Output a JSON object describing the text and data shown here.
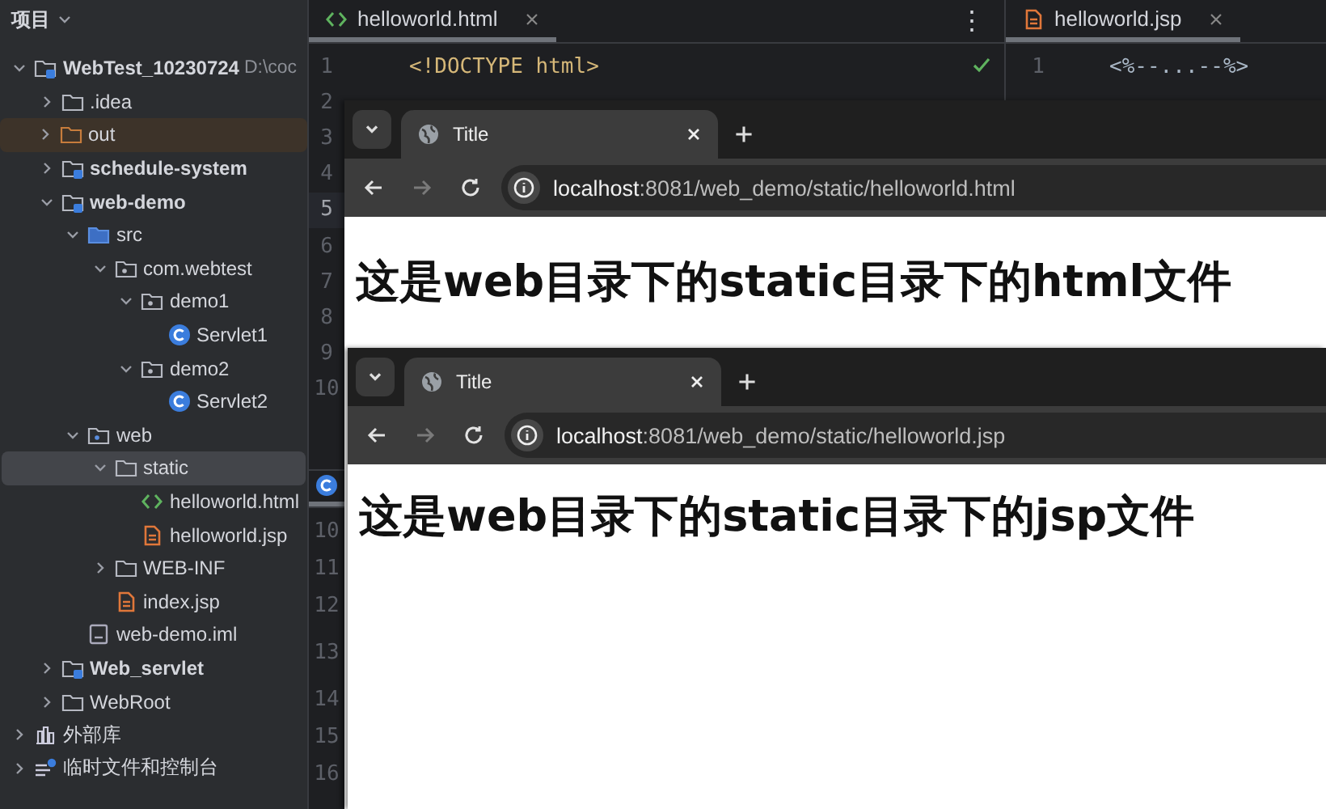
{
  "sidebar": {
    "title": "项目",
    "tree": [
      {
        "label": "WebTest_10230724",
        "path": "D:\\coc",
        "kind": "module",
        "expanded": true,
        "selected": false,
        "children": [
          {
            "label": ".idea",
            "kind": "folder",
            "expanded": false,
            "selected": false
          },
          {
            "label": "out",
            "kind": "excluded",
            "expanded": false,
            "selected": false
          },
          {
            "label": "schedule-system",
            "kind": "module",
            "expanded": false,
            "selected": false
          },
          {
            "label": "web-demo",
            "kind": "module",
            "expanded": true,
            "selected": false,
            "children": [
              {
                "label": "src",
                "kind": "source",
                "expanded": true,
                "selected": false,
                "children": [
                  {
                    "label": "com.webtest",
                    "kind": "package",
                    "expanded": true,
                    "selected": false,
                    "children": [
                      {
                        "label": "demo1",
                        "kind": "package",
                        "expanded": true,
                        "selected": false,
                        "children": [
                          {
                            "label": "Servlet1",
                            "kind": "class",
                            "selected": false
                          }
                        ]
                      },
                      {
                        "label": "demo2",
                        "kind": "package",
                        "expanded": true,
                        "selected": false,
                        "children": [
                          {
                            "label": "Servlet2",
                            "kind": "class",
                            "selected": false
                          }
                        ]
                      }
                    ]
                  }
                ]
              },
              {
                "label": "web",
                "kind": "web",
                "expanded": true,
                "selected": false,
                "children": [
                  {
                    "label": "static",
                    "kind": "folder",
                    "expanded": true,
                    "selected": true,
                    "children": [
                      {
                        "label": "helloworld.html",
                        "kind": "html",
                        "selected": false
                      },
                      {
                        "label": "helloworld.jsp",
                        "kind": "jsp",
                        "selected": false
                      }
                    ]
                  },
                  {
                    "label": "WEB-INF",
                    "kind": "folder",
                    "expanded": false,
                    "selected": false
                  },
                  {
                    "label": "index.jsp",
                    "kind": "jsp",
                    "selected": false
                  }
                ]
              },
              {
                "label": "web-demo.iml",
                "kind": "file",
                "selected": false
              }
            ]
          },
          {
            "label": "Web_servlet",
            "kind": "module",
            "expanded": false,
            "selected": false
          },
          {
            "label": "WebRoot",
            "kind": "folder",
            "expanded": false,
            "selected": false
          }
        ]
      },
      {
        "label": "外部库",
        "kind": "library",
        "expanded": false,
        "selected": false
      },
      {
        "label": "临时文件和控制台",
        "kind": "scratch",
        "expanded": false,
        "selected": false
      }
    ]
  },
  "editor": {
    "left": {
      "menu": "⋮",
      "tabs": [
        {
          "label": "helloworld.html",
          "kind": "html",
          "selected": true
        }
      ],
      "lines": [
        {
          "number": "1",
          "code": "<!DOCTYPE html>",
          "current": false
        },
        {
          "number": "2",
          "current": false
        },
        {
          "number": "3",
          "current": false
        },
        {
          "number": "4",
          "current": false
        },
        {
          "number": "5",
          "current": true
        },
        {
          "number": "6",
          "current": false
        },
        {
          "number": "7",
          "current": false
        },
        {
          "number": "8",
          "current": false
        },
        {
          "number": "9",
          "current": false
        },
        {
          "number": "10",
          "current": false
        }
      ]
    },
    "lower": {
      "tabs": [
        {
          "kind": "class",
          "selected": true
        }
      ],
      "lines": [
        {
          "number": "10",
          "wrapped": false
        },
        {
          "number": "11",
          "wrapped": false
        },
        {
          "number": "12",
          "wrapped": false
        },
        {
          "number": "13",
          "wrapped": true
        },
        {
          "number": "14",
          "wrapped": false
        },
        {
          "number": "15",
          "wrapped": false
        },
        {
          "number": "16",
          "wrapped": false
        }
      ]
    },
    "right": {
      "tabs": [
        {
          "label": "helloworld.jsp",
          "kind": "jsp",
          "selected": true
        }
      ],
      "lines": [
        {
          "number": "1",
          "code": "<%--...--%>",
          "current": false
        }
      ]
    }
  },
  "browsers": [
    {
      "tab": "Title",
      "url_host": "localhost",
      "url_path": ":8081/web_demo/static/helloworld.html",
      "nav": [
        {
          "kind": "back",
          "disabled": false
        },
        {
          "kind": "forward",
          "disabled": true
        },
        {
          "kind": "reload",
          "disabled": false
        }
      ],
      "heading": "这是web目录下的static目录下的html文件"
    },
    {
      "tab": "Title",
      "url_host": "localhost",
      "url_path": ":8081/web_demo/static/helloworld.jsp",
      "nav": [
        {
          "kind": "back",
          "disabled": false
        },
        {
          "kind": "forward",
          "disabled": true
        },
        {
          "kind": "reload",
          "disabled": false
        }
      ],
      "heading": "这是web目录下的static目录下的jsp文件"
    }
  ]
}
